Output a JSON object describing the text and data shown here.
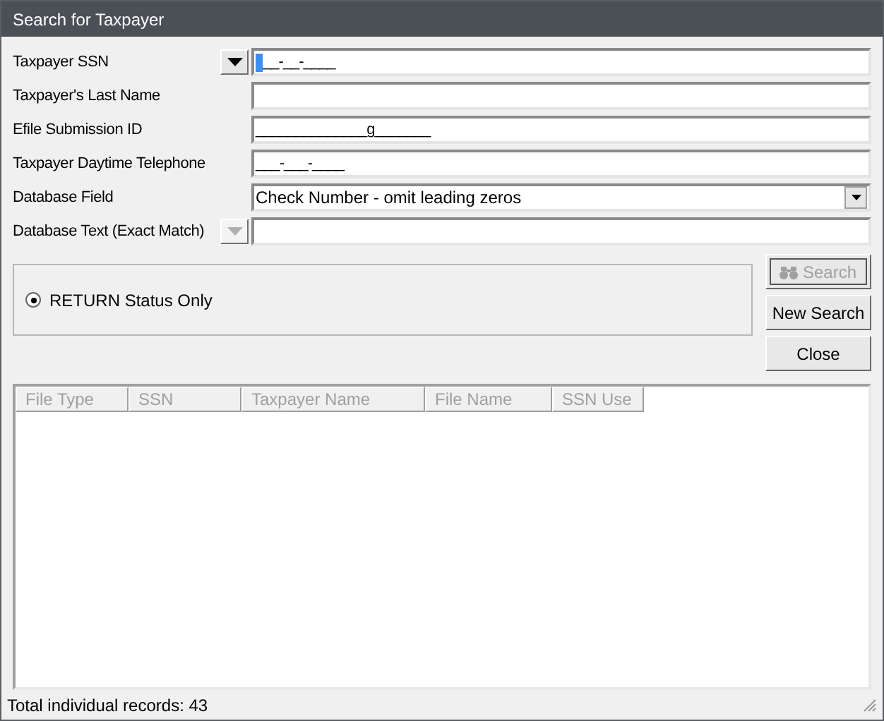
{
  "window": {
    "title": "Search for Taxpayer"
  },
  "fields": [
    {
      "label": "Taxpayer SSN",
      "kind": "text",
      "value": "__-__-____",
      "cursor": true,
      "selector": {
        "disabled": false
      }
    },
    {
      "label": "Taxpayer's Last Name",
      "kind": "text"
    },
    {
      "label": "Efile Submission ID",
      "kind": "text",
      "value": "______________g_______"
    },
    {
      "label": "Taxpayer Daytime Telephone",
      "kind": "text",
      "value": "___-___-____"
    },
    {
      "label": "Database Field",
      "kind": "select",
      "value": "Check Number - omit leading zeros"
    },
    {
      "label": "Database Text (Exact Match)",
      "kind": "text",
      "selector": {
        "disabled": true
      }
    }
  ],
  "options": [
    {
      "label": "RETURN Status Only",
      "selected": true
    }
  ],
  "buttons": [
    {
      "label": "Search",
      "kind": "search",
      "disabled": true
    },
    {
      "label": "New Search",
      "kind": "plain",
      "disabled": false
    },
    {
      "label": "Close",
      "kind": "plain",
      "disabled": false
    }
  ],
  "table": {
    "columns": [
      {
        "label": "File Type",
        "disabled": true
      },
      {
        "label": "SSN",
        "disabled": true
      },
      {
        "label": "Taxpayer Name",
        "disabled": true
      },
      {
        "label": "File Name",
        "disabled": true
      },
      {
        "label": "SSN Use",
        "disabled": true
      }
    ]
  },
  "status_bar": {
    "text": "Total individual records: 43"
  }
}
